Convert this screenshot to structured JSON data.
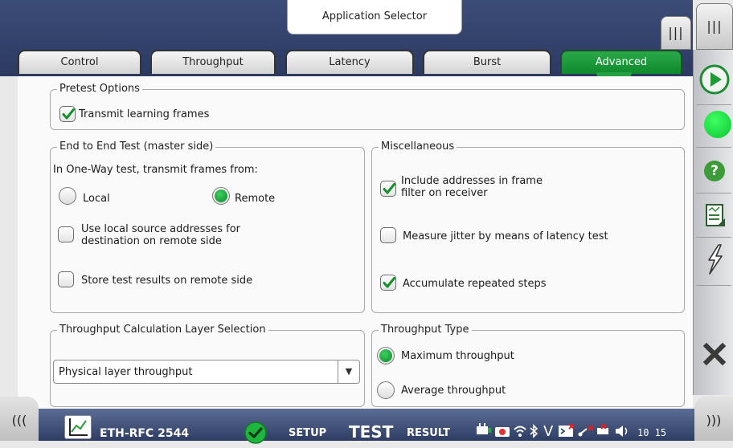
{
  "header": {
    "app_selector": "Application Selector",
    "grip_label": "|||"
  },
  "tabs": [
    {
      "label": "Control",
      "active": false
    },
    {
      "label": "Throughput",
      "active": false
    },
    {
      "label": "Latency",
      "active": false
    },
    {
      "label": "Burst",
      "active": false
    },
    {
      "label": "Advanced",
      "active": true
    }
  ],
  "pretest": {
    "title": "Pretest Options",
    "transmit_learning": {
      "label": "Transmit learning frames",
      "checked": true
    }
  },
  "end_to_end": {
    "title": "End to End Test (master side)",
    "prompt": "In One-Way test, transmit frames from:",
    "local_label": "Local",
    "remote_label": "Remote",
    "selected": "Remote",
    "use_local_src": {
      "label_line1": "Use local source addresses for",
      "label_line2": "destination on remote side",
      "checked": false
    },
    "store_results": {
      "label": "Store test results on remote side",
      "checked": false
    }
  },
  "misc": {
    "title": "Miscellaneous",
    "include_addresses": {
      "label_line1": "Include addresses in frame",
      "label_line2": "filter on receiver",
      "checked": true
    },
    "measure_jitter": {
      "label": "Measure jitter by means of latency test",
      "checked": false
    },
    "accumulate": {
      "label": "Accumulate repeated steps",
      "checked": true
    }
  },
  "calc_layer": {
    "title": "Throughput Calculation Layer Selection",
    "selected": "Physical layer throughput"
  },
  "throughput_type": {
    "title": "Throughput Type",
    "maximum_label": "Maximum throughput",
    "average_label": "Average throughput",
    "selected": "Maximum throughput"
  },
  "statusbar": {
    "left_chevron": "(((",
    "right_chevron": ")))",
    "app_name": "ETH-RFC 2544",
    "setup": "SETUP",
    "test": "TEST",
    "result": "RESULT",
    "clock": "10 15"
  },
  "sidebar_icons": [
    "play-icon",
    "status-led-icon",
    "help-icon",
    "report-icon",
    "lightning-icon",
    "close-icon"
  ],
  "colors": {
    "accent_green": "#14962f",
    "header_blue": "#2f3d63",
    "help_green": "#3d9b3a"
  }
}
